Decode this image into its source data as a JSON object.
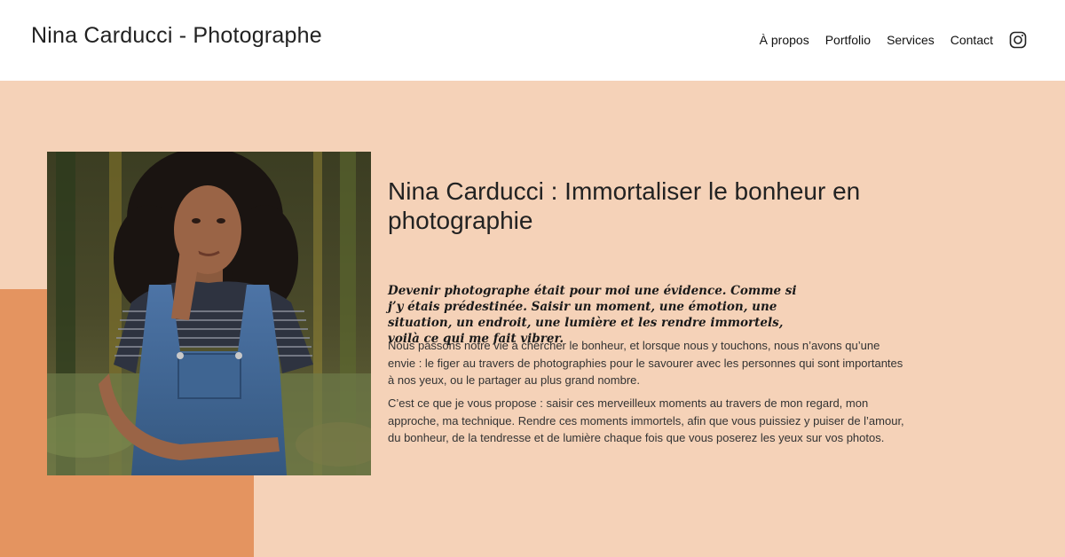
{
  "header": {
    "site_title": "Nina Carducci - Photographe",
    "nav": {
      "about": "À propos",
      "portfolio": "Portfolio",
      "services": "Services",
      "contact": "Contact"
    },
    "social_icon": "instagram-icon"
  },
  "hero": {
    "headline": "Nina Carducci : Immortaliser le bonheur en photographie",
    "quote": "Devenir photographe était pour moi une évidence. Comme si j’y étais prédestinée. Saisir un moment, une émotion, une situation, un endroit, une lumière et les rendre immortels, voilà ce qui me fait vibrer.",
    "paragraph_1": "Nous passons notre vie à chercher le bonheur, et lorsque nous y touchons, nous n’avons qu’une envie : le figer au travers de photographies pour le savourer avec les personnes qui sont importantes à nos yeux, ou le partager au plus grand nombre.",
    "paragraph_2": "C’est ce que je vous propose : saisir ces merveilleux moments au travers de mon regard, mon approche, ma technique. Rendre ces moments immortels, afin que vous puissiez y puiser de l’amour, du bonheur, de la tendresse et de lumière chaque fois que vous poserez les yeux sur vos photos."
  },
  "colors": {
    "hero_background": "#f5d2b8",
    "accent_block": "#e49460",
    "header_background": "#ffffff",
    "text": "#222222"
  }
}
